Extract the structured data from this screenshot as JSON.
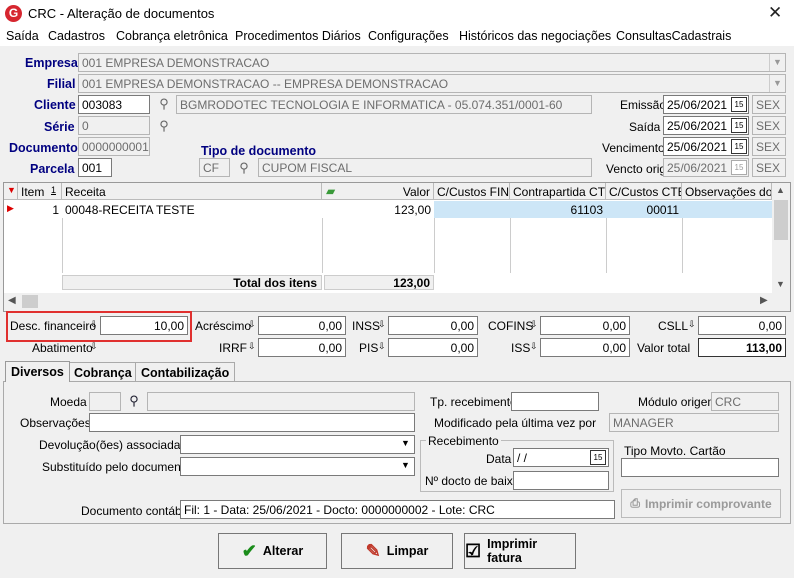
{
  "window": {
    "title": "CRC - Alteração de documentos",
    "logo_letter": "G",
    "close_glyph": "✕"
  },
  "menu": [
    "Saída",
    "Cadastros",
    "Cobrança eletrônica",
    "Procedimentos Diários",
    "Configurações",
    "Históricos das negociações",
    "ConsultasCadastrais"
  ],
  "header": {
    "empresa_label": "Empresa",
    "empresa_value": "001 EMPRESA DEMONSTRACAO",
    "filial_label": "Filial",
    "filial_value": "001 EMPRESA DEMONSTRACAO -- EMPRESA DEMONSTRACAO",
    "cliente_label": "Cliente",
    "cliente_code": "003083",
    "cliente_name": "BGMRODOTEC TECNOLOGIA  E INFORMATICA - 05.074.351/0001-60",
    "serie_label": "Série",
    "serie_value": "0",
    "documento_label": "Documento",
    "documento_value": "0000000001",
    "tipo_documento_label": "Tipo de documento",
    "tipo_code": "CF",
    "tipo_name": "CUPOM FISCAL",
    "parcela_label": "Parcela",
    "parcela_value": "001",
    "emissao_label": "Emissão",
    "emissao_value": "25/06/2021",
    "emissao_day": "SEX",
    "saida_label": "Saída",
    "saida_value": "25/06/2021",
    "saida_day": "SEX",
    "vencimento_label": "Vencimento",
    "vencimento_value": "25/06/2021",
    "vencimento_day": "SEX",
    "vencto_orig_label": "Vencto orig",
    "vencto_orig_value": "25/06/2021",
    "vencto_orig_day": "SEX",
    "cal_glyph": "15"
  },
  "grid": {
    "headers": {
      "item": "Item",
      "sort": "1",
      "receita": "Receita",
      "valor": "Valor",
      "cc_fin": "C/Custos FIN",
      "contrapartida": "Contrapartida CTB",
      "cc_ctb": "C/Custos CTB",
      "obs": "Observações do ite"
    },
    "rows": [
      {
        "item": "1",
        "receita": "00048-RECEITA TESTE",
        "valor": "123,00",
        "cc_fin": "",
        "contrapartida": "61103",
        "cc_ctb": "00011",
        "obs": ""
      }
    ],
    "total_label": "Total dos itens",
    "total_value": "123,00"
  },
  "totals": {
    "desc_fin_label": "Desc. financeiro",
    "desc_fin_value": "10,00",
    "acrescimo_label": "Acréscimo",
    "acrescimo_value": "0,00",
    "inss_label": "INSS",
    "inss_value": "0,00",
    "cofins_label": "COFINS",
    "cofins_value": "0,00",
    "csll_label": "CSLL",
    "csll_value": "0,00",
    "abatimento_label": "Abatimento",
    "irrf_label": "IRRF",
    "irrf_value": "0,00",
    "pis_label": "PIS",
    "pis_value": "0,00",
    "iss_label": "ISS",
    "iss_value": "0,00",
    "valor_total_label": "Valor total",
    "valor_total_value": "113,00"
  },
  "tabs": [
    "Diversos",
    "Cobrança",
    "Contabilização"
  ],
  "diversos": {
    "moeda_label": "Moeda",
    "observacoes_label": "Observações",
    "devolucoes_label": "Devolução(ões) associada(s)",
    "substituido_label": "Substituído pelo documento",
    "tp_recebimento_label": "Tp. recebimento",
    "modulo_origem_label": "Módulo origem",
    "modulo_origem_value": "CRC",
    "modificado_label": "Modificado pela última vez por",
    "modificado_value": "MANAGER",
    "recebimento_group": "Recebimento",
    "data_label": "Data",
    "data_value": " /  /",
    "n_docto_baixa_label": "Nº docto de baixa",
    "tipo_movto_cartao_label": "Tipo Movto. Cartão",
    "imprimir_comprovante_label": "Imprimir comprovante",
    "documento_contabil_label": "Documento contábil",
    "documento_contabil_value": "Fil: 1 - Data: 25/06/2021 - Docto: 0000000002 - Lote: CRC"
  },
  "buttons": {
    "alterar": "Alterar",
    "limpar": "Limpar",
    "imprimir_fatura": "Imprimir fatura"
  },
  "colors": {
    "label_blue": "#000080",
    "highlight_red": "#e0302f",
    "selection": "#cde6f7"
  }
}
